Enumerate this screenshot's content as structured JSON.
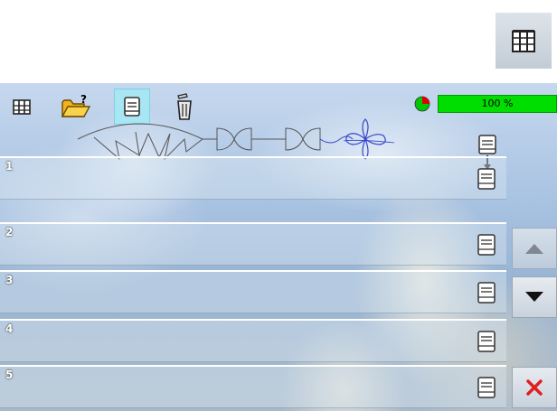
{
  "toolbar": {
    "icons": [
      "library-icon",
      "open-folder-icon",
      "save-icon",
      "trash-icon"
    ],
    "active": "save-icon"
  },
  "status": {
    "progress_label": "100 %",
    "progress_fraction": 1.0,
    "progress_color": "#00dd00"
  },
  "slots": [
    {
      "number": "1"
    },
    {
      "number": "2"
    },
    {
      "number": "3"
    },
    {
      "number": "4"
    },
    {
      "number": "5"
    }
  ],
  "colors": {
    "accent_active": "#a8e6f4",
    "delete": "#e02020",
    "stitch_preview_selected": "#3344cc"
  }
}
